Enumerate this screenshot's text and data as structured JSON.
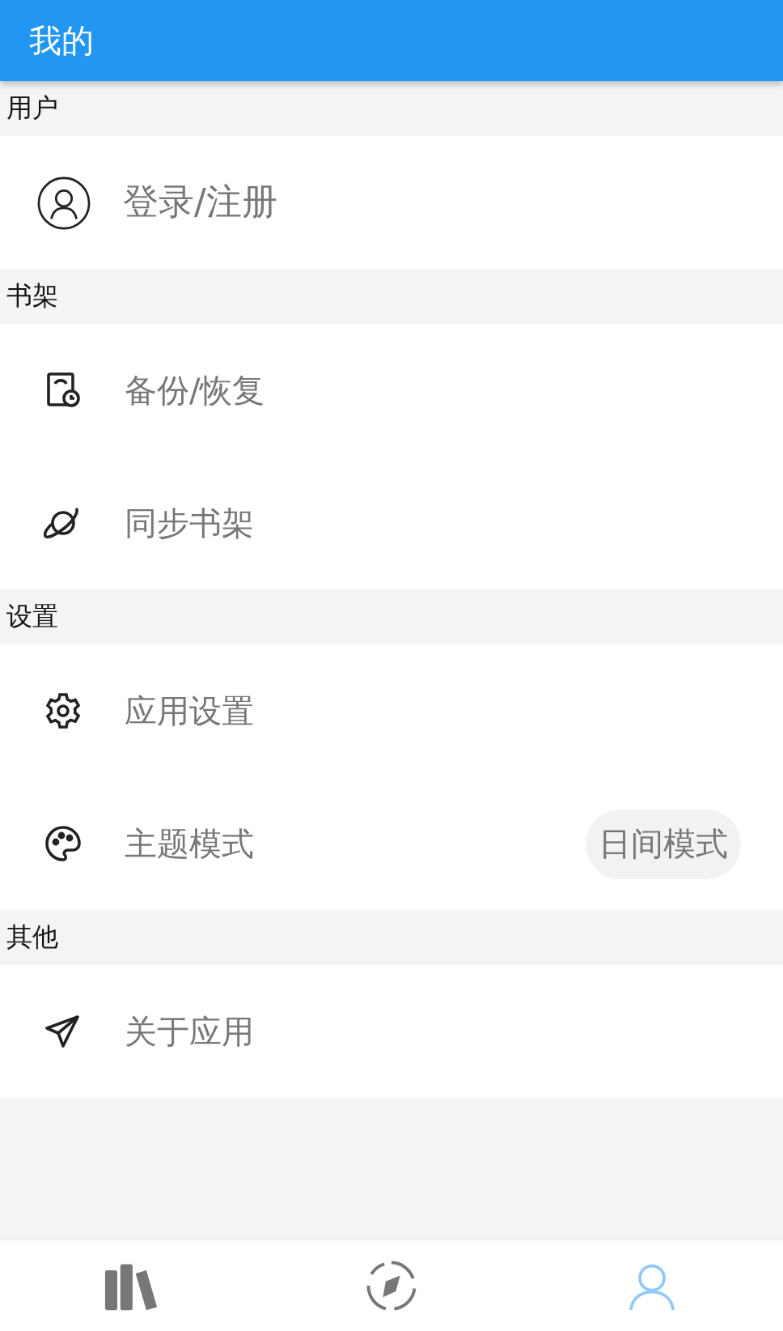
{
  "app_bar": {
    "title": "我的"
  },
  "sections": [
    {
      "title": "用户",
      "items": [
        {
          "kind": "account",
          "label": "登录/注册"
        }
      ]
    },
    {
      "title": "书架",
      "items": [
        {
          "kind": "plain",
          "label": "备份/恢复"
        },
        {
          "kind": "plain",
          "label": "同步书架"
        }
      ]
    },
    {
      "title": "设置",
      "items": [
        {
          "kind": "plain",
          "label": "应用设置"
        },
        {
          "kind": "value",
          "label": "主题模式",
          "value": "日间模式"
        }
      ]
    },
    {
      "title": "其他",
      "items": [
        {
          "kind": "plain",
          "label": "关于应用"
        }
      ]
    }
  ],
  "bottom_nav": [
    {
      "selected": false
    },
    {
      "selected": false
    },
    {
      "selected": true
    }
  ]
}
